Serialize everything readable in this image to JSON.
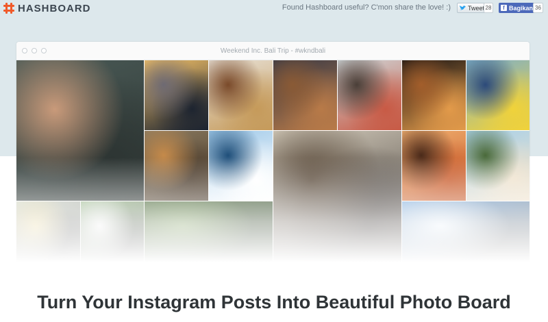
{
  "brand": {
    "name": "HASHBOARD"
  },
  "share": {
    "prompt": "Found Hashboard useful? C'mon share the love! :)",
    "tweet_label": "Tweet",
    "tweet_count": "28",
    "facebook_label": "Bagikan",
    "facebook_count": "36"
  },
  "window": {
    "title": "Weekend Inc. Bali Trip - #wkndbali"
  },
  "photos": [
    {
      "name": "group-selfie-large-photo",
      "colors": [
        "#4a5a56",
        "#c99a7a",
        "#2d3533"
      ]
    },
    {
      "name": "sunset-silhouette-photo",
      "colors": [
        "#f3c168",
        "#6e6a73",
        "#1d2430"
      ]
    },
    {
      "name": "food-bowls-photo",
      "colors": [
        "#e8e2d8",
        "#7a4a2a",
        "#c59a5a"
      ]
    },
    {
      "name": "wooden-facade-photo",
      "colors": [
        "#3a3a45",
        "#8a5a35",
        "#b87a48"
      ]
    },
    {
      "name": "boys-selfie-photo",
      "colors": [
        "#cfd6d8",
        "#4a3f38",
        "#c85a45"
      ]
    },
    {
      "name": "restaurant-interior-photo",
      "colors": [
        "#1b1614",
        "#a35e2b",
        "#e29a4a"
      ]
    },
    {
      "name": "rafting-group-photo",
      "colors": [
        "#7fb0c7",
        "#2c4a7a",
        "#f0d23a"
      ]
    },
    {
      "name": "lion-statue-photo",
      "colors": [
        "#8a7a60",
        "#c58a4a",
        "#4a3a2a"
      ]
    },
    {
      "name": "ocean-waves-photo",
      "colors": [
        "#9ec8e8",
        "#1f4f7a",
        "#ffffff"
      ]
    },
    {
      "name": "cafe-hangout-photo",
      "colors": [
        "#d8d0c0",
        "#5a4a3a",
        "#2a2320"
      ]
    },
    {
      "name": "night-party-photo",
      "colors": [
        "#f0b070",
        "#4a2a1a",
        "#c85a2a"
      ]
    },
    {
      "name": "beach-cliff-photo",
      "colors": [
        "#a8d0e8",
        "#4a6a3a",
        "#efe2cc"
      ]
    },
    {
      "name": "beach-crowd-photo",
      "colors": [
        "#cbd3c5",
        "#e8d8a0",
        "#505050"
      ]
    },
    {
      "name": "group-standing-photo",
      "colors": [
        "#8ab07a",
        "#f0f0f0",
        "#3a3a3a"
      ]
    },
    {
      "name": "jungle-foliage-photo",
      "colors": [
        "#3a5a2a",
        "#7a9a5a",
        "#1e2e18"
      ]
    },
    {
      "name": "boat-dock-photo",
      "colors": [
        "#6aa0d8",
        "#e8f0f8",
        "#5a5a5a"
      ]
    }
  ],
  "headline": "Turn Your Instagram Posts Into Beautiful Photo Board"
}
